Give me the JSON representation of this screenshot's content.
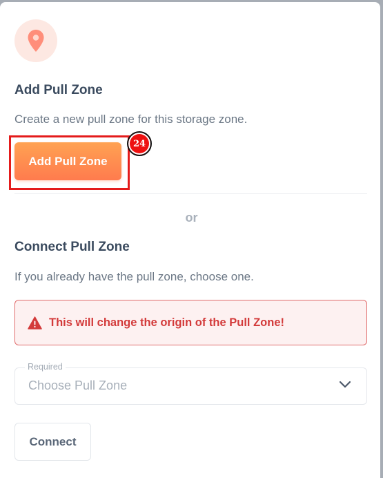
{
  "add_section": {
    "icon": "location-pin-icon",
    "title": "Add Pull Zone",
    "description": "Create a new pull zone for this storage zone.",
    "button_label": "Add Pull Zone",
    "step_badge": "24"
  },
  "separator": {
    "text": "or"
  },
  "connect_section": {
    "title": "Connect Pull Zone",
    "description": "If you already have the pull zone, choose one.",
    "warning": {
      "icon": "warning-triangle-icon",
      "text": "This will change the origin of the Pull Zone!"
    },
    "select": {
      "label": "Required",
      "placeholder": "Choose Pull Zone",
      "icon": "chevron-down-icon"
    },
    "button_label": "Connect"
  },
  "colors": {
    "accent_orange": "#ff8a4f",
    "warning_red": "#d33a3a",
    "annotation_red": "#e41b1b"
  }
}
